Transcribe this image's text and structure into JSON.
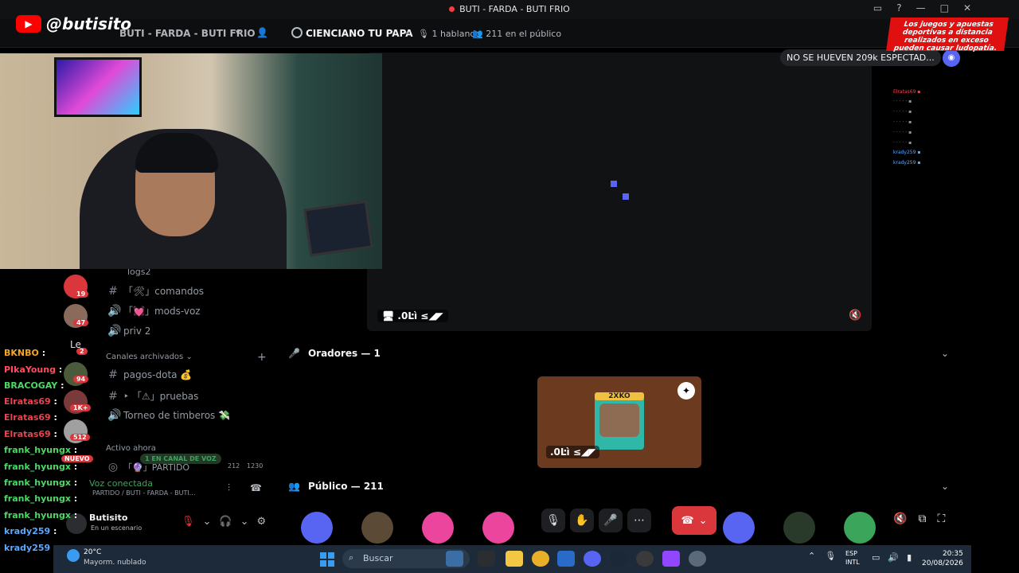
{
  "window": {
    "title": "BUTI - FARDA - BUTI FRIO"
  },
  "header": {
    "server_name": "BUTI - FARDA - BUTI FRIO",
    "stage_title": "CIENCIANO TU PAPA",
    "speaking": "1 hablando",
    "audience": "211 en el público"
  },
  "stream": {
    "handle": "@butisito",
    "youtube_icon": "play-icon"
  },
  "stage": {
    "top_pill": "NO SE HUEVEN 209k ESPECTAD...",
    "screen_label": ".0Ŀì ≤◢◤",
    "speakers_heading": "Oradores — 1",
    "speaker_name": ".0Ŀì ≤◢◤",
    "speaker_game_logo": "2XKO",
    "public_heading": "Público — 211"
  },
  "notice": {
    "text": "Los juegos y apuestas deportivas a distancia realizados en exceso pueden causar ludopatía."
  },
  "channels": {
    "top_partial": "logs2",
    "items": [
      {
        "icon": "#",
        "label": "「🛠」comandos"
      },
      {
        "icon": "🔊",
        "label": "「💓」mods-voz"
      },
      {
        "icon": "🔊",
        "label": "priv 2"
      }
    ],
    "archived_heading": "Canales archivados",
    "archived_items": [
      {
        "icon": "#",
        "label": "pagos-dota 💰"
      },
      {
        "icon": "#",
        "label": "‣ 「⚠」pruebas"
      },
      {
        "icon": "🔊",
        "label": "Torneo de timberos 💸"
      }
    ],
    "active_heading": "Activo ahora",
    "voice_pill": "1 EN CANAL DE VOZ",
    "partido": "「🔮」PARTIDO",
    "partido_count": "212",
    "partido_cap": "1230"
  },
  "servers": {
    "badges": [
      "19",
      "47",
      "2",
      "94",
      "1K+",
      "512",
      "NUEVO"
    ],
    "le_label": "Le"
  },
  "voice": {
    "connected": "Voz conectada",
    "sub": "PARTIDO / BUTI - FARDA - BUTI..."
  },
  "user": {
    "name": "Butisito",
    "status": "En un escenario"
  },
  "chat": [
    {
      "name": "BKNBO",
      "color": "#f5a623"
    },
    {
      "name": "PIkaYoung",
      "color": "#ff4d5e"
    },
    {
      "name": "BRACOGAY",
      "color": "#4cd964"
    },
    {
      "name": "Elratas69",
      "color": "#e8454f"
    },
    {
      "name": "Elratas69",
      "color": "#e8454f"
    },
    {
      "name": "Elratas69",
      "color": "#e8454f"
    },
    {
      "name": "frank_hyungx",
      "color": "#4cd964"
    },
    {
      "name": "frank_hyungx",
      "color": "#4cd964"
    },
    {
      "name": "frank_hyungx",
      "color": "#4cd964"
    },
    {
      "name": "frank_hyungx",
      "color": "#4cd964"
    },
    {
      "name": "frank_hyungx",
      "color": "#4cd964"
    },
    {
      "name": "krady259",
      "color": "#5aa9ff"
    },
    {
      "name": "krady259",
      "color": "#5aa9ff"
    }
  ],
  "taskbar": {
    "temperature": "20°C",
    "weather": "Mayorm. nublado",
    "search_placeholder": "Buscar",
    "lang_top": "ESP",
    "lang_bottom": "INTL",
    "time": "20:35",
    "date": "20/08/2026"
  },
  "colors": {
    "accent": "#5865f2",
    "danger": "#da373c",
    "online": "#3ba55c"
  }
}
